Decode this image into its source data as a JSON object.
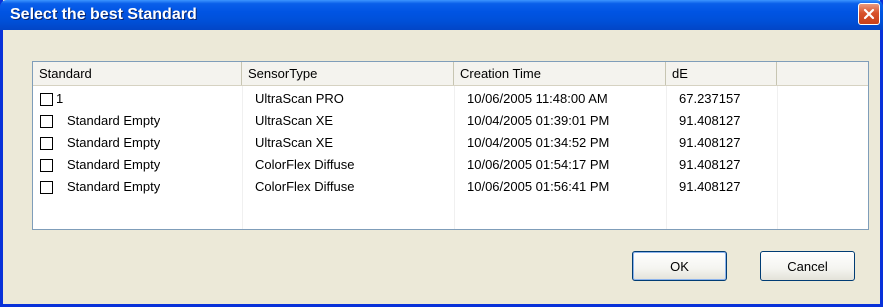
{
  "window": {
    "title": "Select the best Standard"
  },
  "list": {
    "columns": [
      "Standard",
      "SensorType",
      "Creation Time",
      "dE",
      ""
    ],
    "rows": [
      {
        "checked": false,
        "standard": "1",
        "sensor": "UltraScan PRO",
        "time": "10/06/2005 11:48:00 AM",
        "de": "67.237157"
      },
      {
        "checked": false,
        "standard": "Standard Empty",
        "sensor": "UltraScan XE",
        "time": "10/04/2005 01:39:01 PM",
        "de": "91.408127"
      },
      {
        "checked": false,
        "standard": "Standard Empty",
        "sensor": "UltraScan XE",
        "time": "10/04/2005 01:34:52 PM",
        "de": "91.408127"
      },
      {
        "checked": false,
        "standard": "Standard Empty",
        "sensor": "ColorFlex Diffuse",
        "time": "10/06/2005 01:54:17 PM",
        "de": "91.408127"
      },
      {
        "checked": false,
        "standard": "Standard Empty",
        "sensor": "ColorFlex Diffuse",
        "time": "10/06/2005 01:56:41 PM",
        "de": "91.408127"
      }
    ]
  },
  "buttons": {
    "ok": "OK",
    "cancel": "Cancel"
  },
  "icons": {
    "close": "close-icon",
    "checkbox": "checkbox-icon"
  },
  "colors": {
    "titlebar": "#0054E3",
    "close": "#D8522B",
    "dialog_bg": "#ECE9D8"
  }
}
